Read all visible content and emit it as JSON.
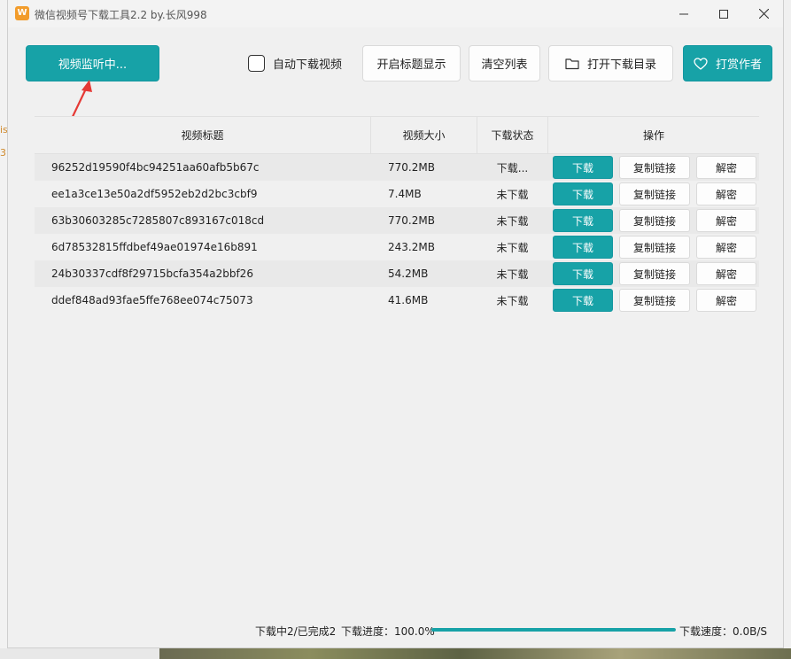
{
  "window": {
    "title": "微信视频号下载工具2.2 by.长风998",
    "icon_glyph": "W"
  },
  "toolbar": {
    "monitor_label": "视频监听中...",
    "auto_download_label": "自动下载视频",
    "auto_download_checked": false,
    "show_title_label": "开启标题显示",
    "clear_list_label": "清空列表",
    "open_dir_label": "打开下载目录",
    "tip_author_label": "打赏作者"
  },
  "table": {
    "headers": [
      "视频标题",
      "视频大小",
      "下载状态",
      "操作"
    ],
    "rows": [
      {
        "title": "96252d19590f4bc94251aa60afb5b67c",
        "size": "770.2MB",
        "status": "下载...",
        "download": "下载",
        "copy": "复制链接",
        "decrypt": "解密"
      },
      {
        "title": "ee1a3ce13e50a2df5952eb2d2bc3cbf9",
        "size": "7.4MB",
        "status": "未下载",
        "download": "下载",
        "copy": "复制链接",
        "decrypt": "解密"
      },
      {
        "title": "63b30603285c7285807c893167c018cd",
        "size": "770.2MB",
        "status": "未下载",
        "download": "下载",
        "copy": "复制链接",
        "decrypt": "解密"
      },
      {
        "title": "6d78532815ffdbef49ae01974e16b891",
        "size": "243.2MB",
        "status": "未下载",
        "download": "下载",
        "copy": "复制链接",
        "decrypt": "解密"
      },
      {
        "title": "24b30337cdf8f29715bcfa354a2bbf26",
        "size": "54.2MB",
        "status": "未下载",
        "download": "下载",
        "copy": "复制链接",
        "decrypt": "解密"
      },
      {
        "title": "ddef848ad93fae5ffe768ee074c75073",
        "size": "41.6MB",
        "status": "未下载",
        "download": "下载",
        "copy": "复制链接",
        "decrypt": "解密"
      }
    ]
  },
  "status": {
    "summary": "下载中2/已完成2",
    "progress_label": "下载进度：100.0%",
    "progress_fraction": 1.0,
    "speed_label": "下载速度：0.0B/S"
  },
  "background_fragments": [
    "is",
    "3"
  ],
  "colors": {
    "accent": "#17a2a7",
    "arrow": "#e53935"
  }
}
